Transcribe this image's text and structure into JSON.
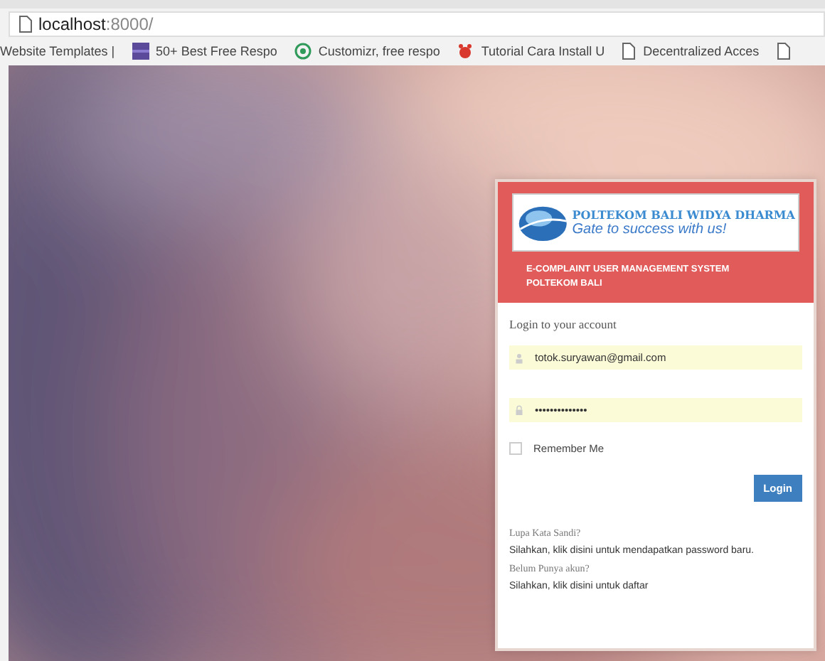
{
  "browser": {
    "url_host": "localhost",
    "url_rest": ":8000/",
    "bookmarks": [
      {
        "label": "Website Templates |",
        "kind": "plain"
      },
      {
        "label": "50+ Best Free Respo",
        "kind": "square"
      },
      {
        "label": "Customizr, free respo",
        "kind": "circle"
      },
      {
        "label": "Tutorial Cara Install U",
        "kind": "bug"
      },
      {
        "label": "Decentralized Acces",
        "kind": "page"
      },
      {
        "kind": "page"
      }
    ]
  },
  "login": {
    "brand_name": "POLTEKOM BALI WIDYA DHARMA",
    "brand_tagline": "Gate to success with us!",
    "system_title": "E-COMPLAINT USER MANAGEMENT SYSTEM",
    "system_subtitle": "POLTEKOM BALI",
    "heading": "Login to your account",
    "email": {
      "value": "totok.suryawan@gmail.com"
    },
    "password": {
      "value": "••••••••••••••"
    },
    "remember": {
      "label": "Remember Me",
      "checked": false
    },
    "button": "Login",
    "help": [
      {
        "question": "Lupa Kata Sandi?",
        "answer": "Silahkan, klik disini untuk mendapatkan password baru."
      },
      {
        "question": "Belum Punya akun?",
        "answer": "Silahkan, klik disini untuk daftar"
      }
    ]
  }
}
